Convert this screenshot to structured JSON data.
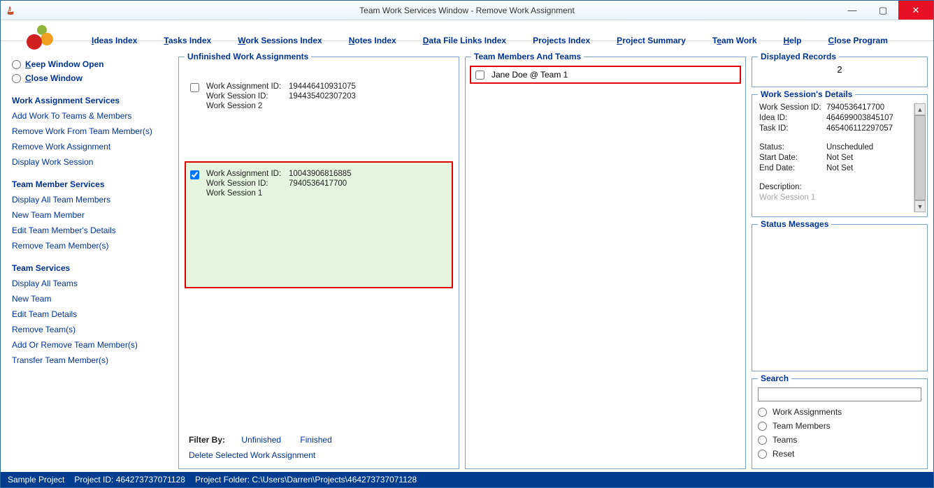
{
  "window": {
    "title": "Team Work Services Window - Remove Work Assignment"
  },
  "menu": {
    "ideas": "Ideas Index",
    "tasks": "Tasks Index",
    "work_sessions": "Work Sessions Index",
    "notes": "Notes Index",
    "data_file": "Data File Links Index",
    "projects": "Projects Index",
    "project_summary": "Project Summary",
    "team_work": "Team Work",
    "help": "Help",
    "close": "Close Program"
  },
  "sidebar": {
    "keep_open": "Keep Window Open",
    "close_window": "Close Window",
    "sections": {
      "work_assignment": {
        "title": "Work Assignment Services",
        "links": [
          "Add Work To Teams & Members",
          "Remove Work From Team Member(s)",
          "Remove Work Assignment",
          "Display Work Session"
        ]
      },
      "team_member": {
        "title": "Team Member Services",
        "links": [
          "Display All Team Members",
          "New Team Member",
          "Edit Team Member's Details",
          "Remove Team Member(s)"
        ]
      },
      "team": {
        "title": "Team Services",
        "links": [
          "Display All Teams",
          "New Team",
          "Edit Team Details",
          "Remove Team(s)",
          "Add Or Remove Team Member(s)",
          "Transfer Team Member(s)"
        ]
      }
    }
  },
  "panels": {
    "assignments_title": "Unfinished Work Assignments",
    "members_title": "Team Members And Teams",
    "displayed_title": "Displayed Records",
    "details_title": "Work Session's Details",
    "status_title": "Status Messages",
    "search_title": "Search"
  },
  "assignments": [
    {
      "selected": false,
      "wa_lbl": "Work Assignment ID:",
      "wa_id": "194446410931075",
      "ws_lbl": "Work Session ID:",
      "ws_id": "194435402307203",
      "name": "Work Session 2"
    },
    {
      "selected": true,
      "wa_lbl": "Work Assignment ID:",
      "wa_id": "10043906816885",
      "ws_lbl": "Work Session ID:",
      "ws_id": "7940536417700",
      "name": "Work Session 1"
    }
  ],
  "filter": {
    "label": "Filter By:",
    "unfinished": "Unfinished",
    "finished": "Finished",
    "delete": "Delete Selected Work Assignment"
  },
  "members": [
    {
      "label": "Jane Doe @ Team 1"
    }
  ],
  "displayed_records": "2",
  "details": {
    "ws_id_lbl": "Work Session ID:",
    "ws_id": "7940536417700",
    "idea_lbl": "Idea ID:",
    "idea_id": "464699003845107",
    "task_lbl": "Task ID:",
    "task_id": "465406112297057",
    "status_lbl": "Status:",
    "status": "Unscheduled",
    "start_lbl": "Start Date:",
    "start": "Not Set",
    "end_lbl": "End Date:",
    "end": "Not Set",
    "desc_lbl": "Description:",
    "ws_name": "Work Session 1"
  },
  "search": {
    "options": [
      "Work Assignments",
      "Team Members",
      "Teams",
      "Reset"
    ]
  },
  "statusbar": {
    "project": "Sample Project",
    "project_id": "Project ID: 464273737071128",
    "folder": "Project Folder: C:\\Users\\Darren\\Projects\\464273737071128"
  }
}
